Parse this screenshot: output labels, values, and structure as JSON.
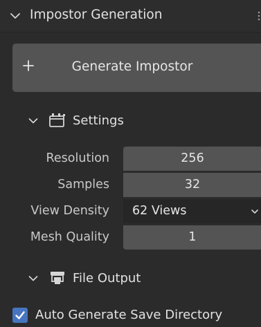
{
  "panel": {
    "title": "Impostor Generation",
    "expanded": true
  },
  "generate_button": {
    "label": "Generate Impostor",
    "icon": "plus-icon"
  },
  "settings": {
    "label": "Settings",
    "icon": "settings-panel-icon",
    "properties": [
      {
        "label": "Resolution",
        "value": "256",
        "type": "number"
      },
      {
        "label": "Samples",
        "value": "32",
        "type": "number"
      },
      {
        "label": "View Density",
        "value": "62 Views",
        "type": "dropdown"
      },
      {
        "label": "Mesh Quality",
        "value": "1",
        "type": "number"
      }
    ]
  },
  "file_output": {
    "label": "File Output",
    "icon": "file-output-icon",
    "auto_generate": {
      "label": "Auto Generate Save Directory",
      "checked": true
    }
  },
  "colors": {
    "background": "#2b2b2b",
    "button": "#545454",
    "dropdown": "#262626",
    "checkbox_accent": "#4775c0",
    "text": "#e2e2e2"
  }
}
